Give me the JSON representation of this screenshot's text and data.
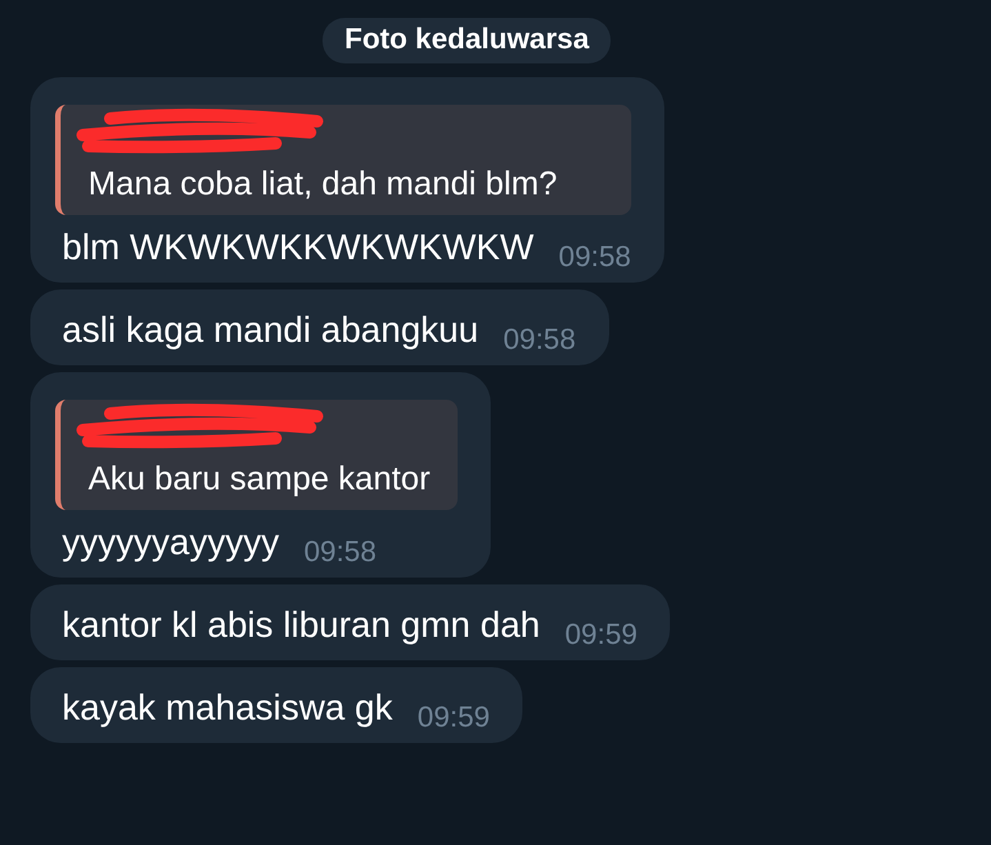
{
  "service_pill": "Foto kedaluwarsa",
  "messages": [
    {
      "kind": "reply",
      "quote": "Mana coba liat, dah mandi blm?",
      "text": "blm WKWKWKKWKWKWKW",
      "time": "09:58"
    },
    {
      "kind": "plain",
      "text": "asli kaga mandi abangkuu",
      "time": "09:58"
    },
    {
      "kind": "reply",
      "quote": "Aku baru sampe kantor",
      "text": "yyyyyyayyyyy",
      "time": "09:58"
    },
    {
      "kind": "plain",
      "text": "kantor kl abis liburan gmn dah",
      "time": "09:59"
    },
    {
      "kind": "plain",
      "text": "kayak mahasiswa gk",
      "time": "09:59"
    }
  ]
}
